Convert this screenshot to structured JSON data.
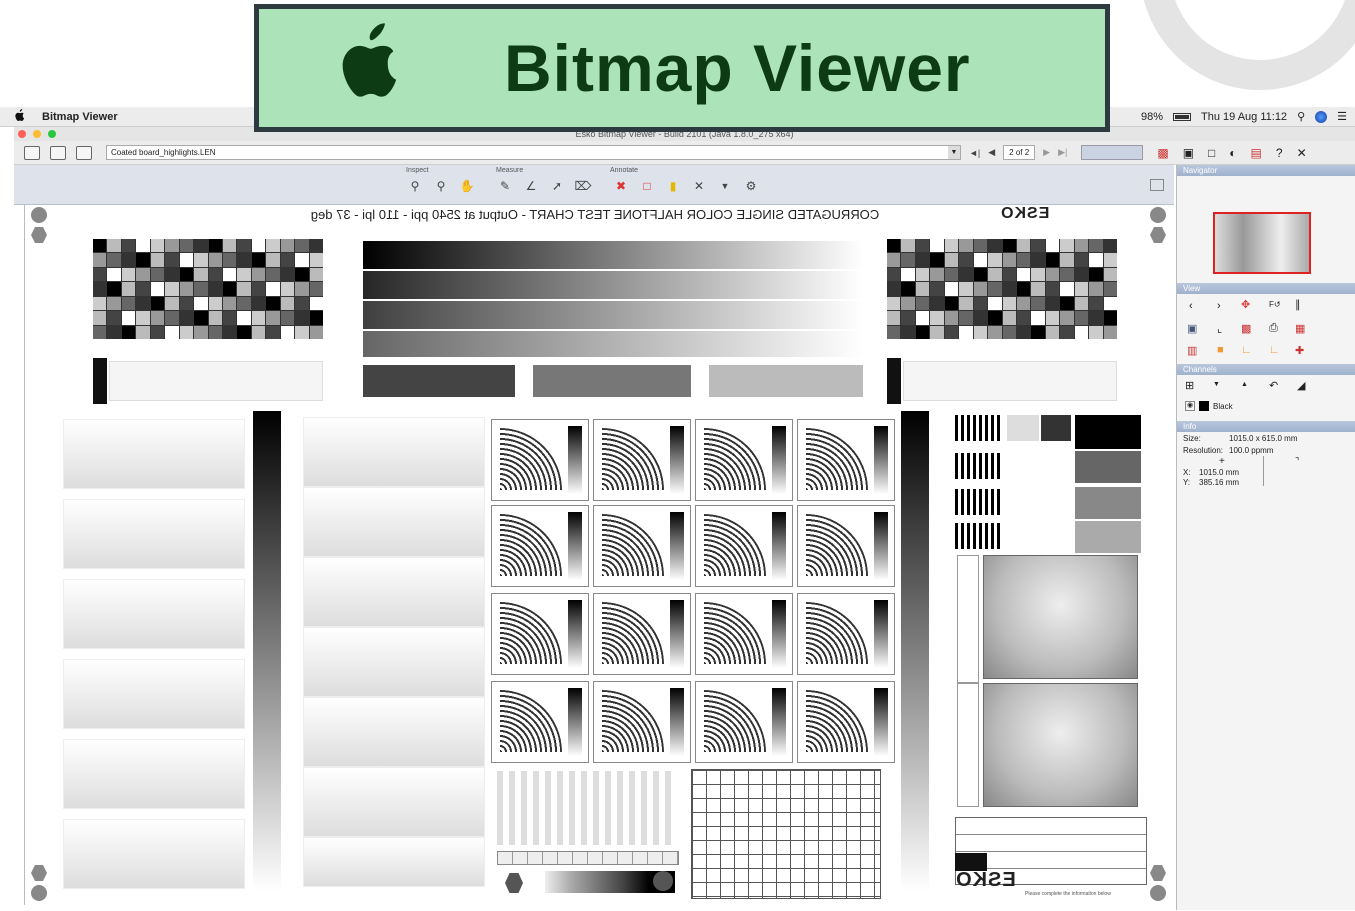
{
  "menubar": {
    "app_name": "Bitmap Viewer",
    "battery": "98%",
    "datetime": "Thu 19 Aug  11:12"
  },
  "window": {
    "title": "Esko Bitmap Viewer - Build 2101 (Java 1.8.0_275 x64)"
  },
  "toolbar": {
    "file_name": "Coated board_highlights.LEN",
    "page_indicator": "2 of 2"
  },
  "tool_groups": {
    "inspect": "Inspect",
    "measure": "Measure",
    "annotate": "Annotate"
  },
  "document": {
    "chart_title": "CORRUGATED SINGLE COLOR HALFTONE TEST CHART - Output at 2540 ppi - 110 lpi - 37 deg",
    "brand": "ESKO",
    "bottom_note": "Please complete the information below"
  },
  "banner": {
    "title": "Bitmap Viewer"
  },
  "panel": {
    "navigator": "Navigator",
    "view": "View",
    "channels": "Channels",
    "channel_name": "Black",
    "info": "Info",
    "size_label": "Size:",
    "size_value": "1015.0 x 615.0 mm",
    "resolution_label": "Resolution:",
    "resolution_value": "100.0 ppmm",
    "x_label": "X:",
    "x_value": "1015.0 mm",
    "y_label": "Y:",
    "y_value": "385.16 mm"
  }
}
